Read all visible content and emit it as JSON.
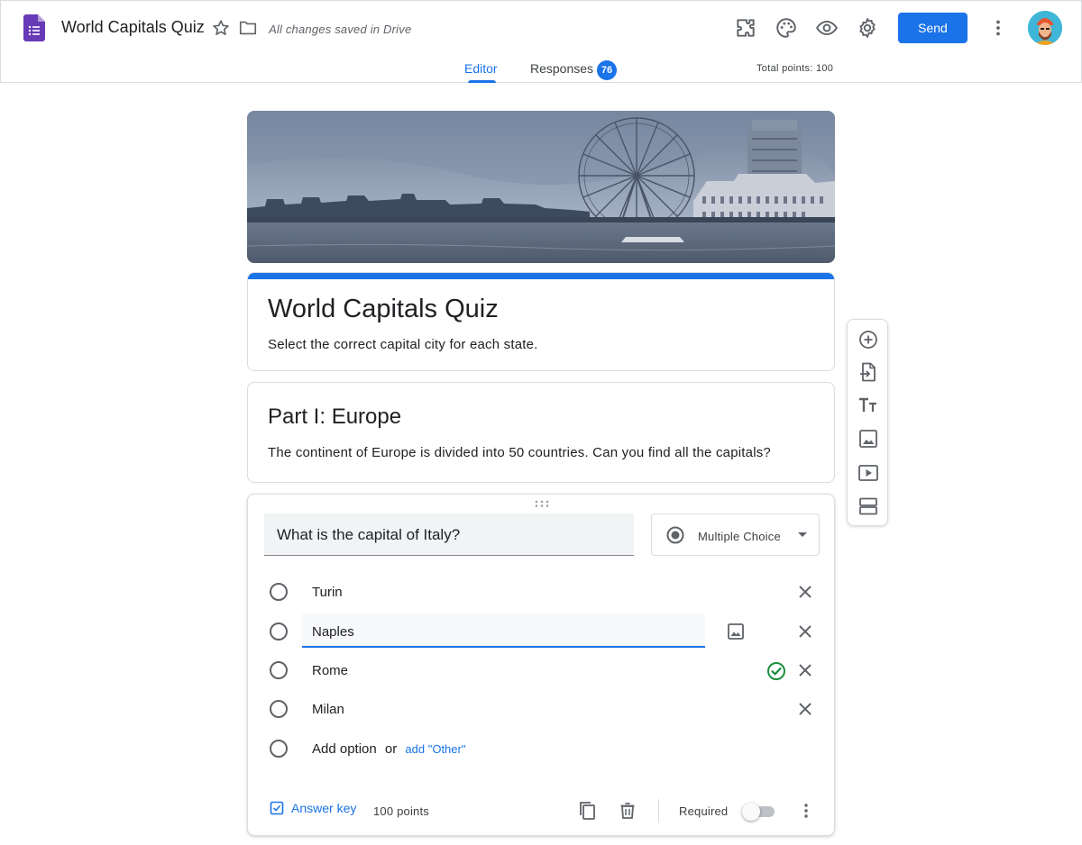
{
  "header": {
    "doc_title": "World Capitals Quiz",
    "save_status": "All changes saved in Drive",
    "send_label": "Send",
    "total_points": "Total points: 100"
  },
  "tabs": [
    {
      "label": "Editor",
      "active": true
    },
    {
      "label": "Responses",
      "badge": "76"
    }
  ],
  "form": {
    "title": "World Capitals Quiz",
    "description": "Select the correct capital city for each state."
  },
  "section": {
    "title": "Part I: Europe",
    "description": "The continent of Europe is divided into 50 countries. Can you find all the capitals?"
  },
  "question": {
    "text": "What is the capital of Italy?",
    "type": "Multiple Choice",
    "options": [
      {
        "label": "Turin"
      },
      {
        "label": "Naples",
        "editing": true
      },
      {
        "label": "Rome",
        "correct": true
      },
      {
        "label": "Milan"
      }
    ],
    "add_option": "Add option",
    "or_text": "or",
    "add_other": "add \"Other\"",
    "answer_key": "Answer key",
    "points": "100 points",
    "required_label": "Required",
    "required": false
  },
  "colors": {
    "accent": "#1a73e8",
    "correct": "#1e8e3e",
    "form_icon": "#673ab7"
  },
  "icons": [
    "forms-app-icon",
    "star-icon",
    "folder-icon",
    "addons-icon",
    "palette-icon",
    "preview-eye-icon",
    "settings-gear-icon",
    "more-vert-icon",
    "add-question-icon",
    "import-questions-icon",
    "add-title-icon",
    "add-image-icon",
    "add-video-icon",
    "add-section-icon"
  ]
}
